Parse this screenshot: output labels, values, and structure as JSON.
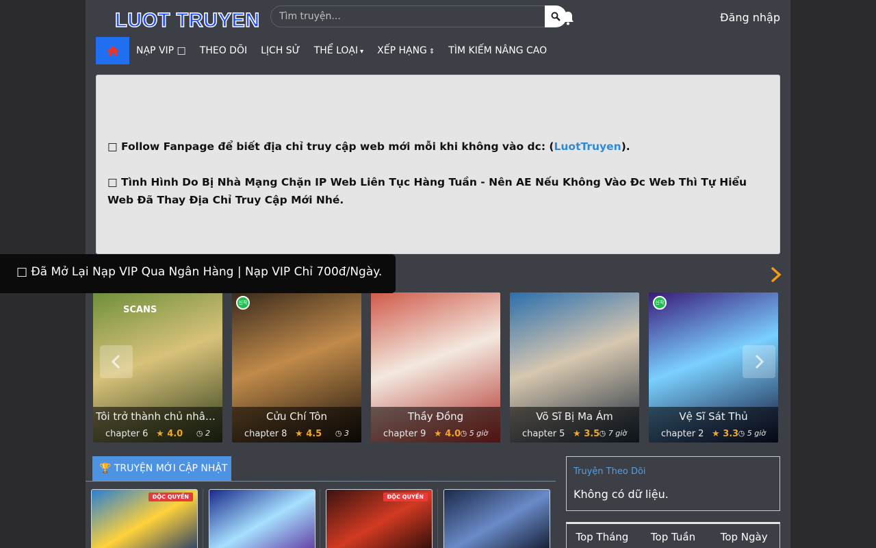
{
  "header": {
    "logo_text": "LUOT TRUYEN",
    "search_placeholder": "Tìm truyện...",
    "login_label": "Đăng nhập"
  },
  "nav": {
    "items": [
      {
        "label": "NẠP VIP ",
        "suffix": "□"
      },
      {
        "label": "THEO DÕI",
        "suffix": ""
      },
      {
        "label": "LỊCH SỬ",
        "suffix": ""
      },
      {
        "label": "THỂ LOẠI",
        "suffix": "▾"
      },
      {
        "label": "XẾP HẠNG",
        "suffix": "⇕"
      },
      {
        "label": "TÌM KIẾM NÂNG CAO",
        "suffix": ""
      }
    ]
  },
  "notice": {
    "line1_prefix": "□ Follow Fanpage để biết địa chỉ truy cập web mới mỗi khi không vào dc: (",
    "line1_link": "LuotTruyen",
    "line1_suffix": ").",
    "line2": "□ Tình Hình Do Bị Nhà Mạng Chặn IP Web Liên Tục Hàng Tuần - Nên AE Nếu Không Vào Đc Web Thì Tự Hiểu Web Đã Thay Địa Chỉ Truy Cập Mới Nhé."
  },
  "toast": {
    "text": "□ Đã Mở Lại Nạp VIP Qua Ngân Hàng | Nạp VIP Chỉ 700đ/Ngày."
  },
  "carousel": [
    {
      "title": "Tôi trở thành chủ nhân ...",
      "chapter": "chapter 6",
      "rating": "4.0",
      "time": "2",
      "colors": [
        "#6f8f3a",
        "#d8c27a",
        "#2c3a1a"
      ],
      "new_badge": false,
      "scans_label": "SCANS"
    },
    {
      "title": "Cửu Chí Tôn",
      "chapter": "chapter 8",
      "rating": "4.5",
      "time": "3",
      "colors": [
        "#3a2a1c",
        "#c08a4a",
        "#1a120c"
      ],
      "new_badge": true
    },
    {
      "title": "Thầy Đồng",
      "chapter": "chapter 9",
      "rating": "4.0",
      "time": "5 giờ",
      "colors": [
        "#d05a4a",
        "#f3e9e0",
        "#b02a22"
      ],
      "new_badge": false
    },
    {
      "title": "Võ Sĩ Bị Ma Ám",
      "chapter": "chapter 5",
      "rating": "3.5",
      "time": "7 giờ",
      "colors": [
        "#2b6fae",
        "#d7c7b0",
        "#1a2a3a"
      ],
      "new_badge": false
    },
    {
      "title": "Vệ Sĩ Sát Thủ",
      "chapter": "chapter 2",
      "rating": "3.3",
      "time": "5 giờ",
      "colors": [
        "#3a1a7a",
        "#7ad0ff",
        "#101030"
      ],
      "new_badge": true
    }
  ],
  "section": {
    "title": "🏆 TRUYỆN MỚI CẬP NHẬT",
    "thumbs": [
      {
        "tag": "ĐỘC QUYỀN",
        "colors": [
          "#2a7fd0",
          "#ffd23a",
          "#14306a"
        ]
      },
      {
        "tag": "",
        "colors": [
          "#1a2a8a",
          "#a6e0ff",
          "#5a2a9a"
        ]
      },
      {
        "tag": "ĐỘC QUYỀN",
        "colors": [
          "#3a1410",
          "#d23a22",
          "#1a0806"
        ]
      },
      {
        "tag": "",
        "colors": [
          "#1a2a4a",
          "#6a8ac8",
          "#0a1020"
        ]
      }
    ]
  },
  "follow_panel": {
    "title": "Truyện Theo Dõi",
    "empty_text": "Không có dữ liệu."
  },
  "top_tabs": [
    "Top Tháng",
    "Top Tuần",
    "Top Ngày"
  ],
  "colors": {
    "accent_blue": "#1f6ff0",
    "section_blue": "#4d93e3",
    "rating_orange": "#f1a626",
    "next_arrow": "#f59a12"
  }
}
